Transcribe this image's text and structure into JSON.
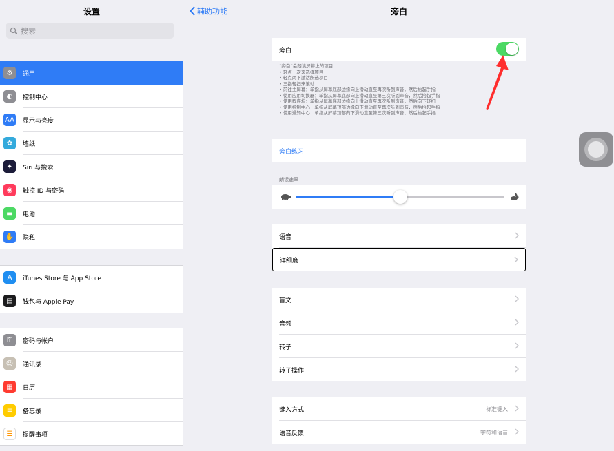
{
  "sidebar": {
    "title": "设置",
    "search_placeholder": "搜索",
    "groups": [
      [
        {
          "label": "通用",
          "icon": "gear-icon",
          "color": "#8e8e93",
          "glyph": "⚙",
          "active": true
        },
        {
          "label": "控制中心",
          "icon": "switches-icon",
          "color": "#8e8e93",
          "glyph": "◐"
        },
        {
          "label": "显示与亮度",
          "icon": "text-size-icon",
          "color": "#2f7cf6",
          "glyph": "AA"
        },
        {
          "label": "墙纸",
          "icon": "flower-icon",
          "color": "#34aadc",
          "glyph": "✿"
        },
        {
          "label": "Siri 与搜索",
          "icon": "siri-icon",
          "color": "#1c1c3a",
          "glyph": "✦"
        },
        {
          "label": "触控 ID 与密码",
          "icon": "fingerprint-icon",
          "color": "#ff3b5c",
          "glyph": "◉"
        },
        {
          "label": "电池",
          "icon": "battery-icon",
          "color": "#4cd964",
          "glyph": "▬"
        },
        {
          "label": "隐私",
          "icon": "hand-icon",
          "color": "#2f7cf6",
          "glyph": "✋"
        }
      ],
      [
        {
          "label": "iTunes Store 与 App Store",
          "icon": "app-store-icon",
          "color": "#1f8ef1",
          "glyph": "A"
        },
        {
          "label": "钱包与 Apple Pay",
          "icon": "wallet-icon",
          "color": "#1c1c1e",
          "glyph": "▤"
        }
      ],
      [
        {
          "label": "密码与帐户",
          "icon": "key-icon",
          "color": "#8e8e93",
          "glyph": "⚿"
        },
        {
          "label": "通讯录",
          "icon": "contacts-icon",
          "color": "#c7c0b4",
          "glyph": "☺"
        },
        {
          "label": "日历",
          "icon": "calendar-icon",
          "color": "#ff3b30",
          "glyph": "▦"
        },
        {
          "label": "备忘录",
          "icon": "notes-icon",
          "color": "#ffcc00",
          "glyph": "≡"
        },
        {
          "label": "提醒事项",
          "icon": "reminders-icon",
          "color": "#ffffff",
          "glyph": "☰"
        }
      ]
    ]
  },
  "nav": {
    "back_label": "辅助功能",
    "title": "旁白"
  },
  "voiceover": {
    "label": "旁白",
    "enabled": true,
    "description": [
      "“旁白”会朗读屏幕上的项目:",
      "• 轻点一次来选择项目",
      "• 轻点两下激活所选项目",
      "• 三指轻扫来滚动",
      "• 前往主屏幕：单指从屏幕底部边缘向上滑动直至再次听到声音，然后抬起手指",
      "• 使用应用切换器：单指从屏幕底部向上滑动直至第三次听到声音，然后抬起手指",
      "• 使用程序坞：单指从屏幕底部边缘向上滑动直至再次听到声音，然后向下轻扫",
      "• 使用控制中心：单指从屏幕顶部边缘向下滑动直至再次听到声音，然后抬起手指",
      "• 使用通知中心：单指从屏幕顶部向下滑动直至第三次听到声音，然后抬起手指"
    ]
  },
  "practice": {
    "label": "旁白练习",
    "color": "#2f7cf6"
  },
  "speaking_rate": {
    "label": "朗读速率",
    "value_fraction": 0.5
  },
  "speech_group": [
    {
      "label": "语音"
    },
    {
      "label": "详细度",
      "selected": true
    }
  ],
  "braille_group": [
    {
      "label": "盲文"
    },
    {
      "label": "音频"
    },
    {
      "label": "转子"
    },
    {
      "label": "转子操作"
    }
  ],
  "typing_group": [
    {
      "label": "键入方式",
      "value": "标准键入"
    },
    {
      "label": "语音反馈",
      "value": "字符和语音"
    }
  ],
  "colors": {
    "accent": "#2f7cf6",
    "toggle_on": "#4cd964",
    "annotation_arrow": "#ff2d2d"
  }
}
